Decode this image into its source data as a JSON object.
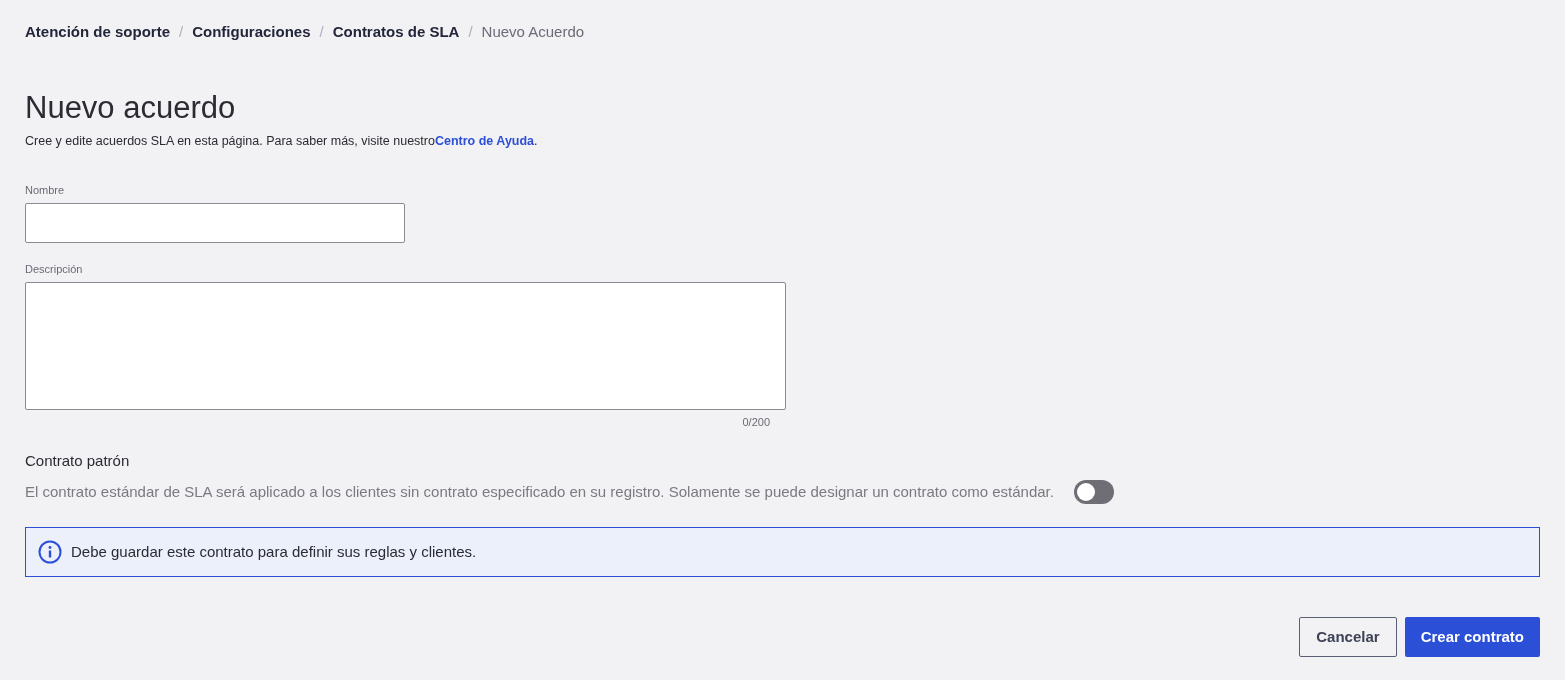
{
  "breadcrumb": [
    {
      "label": "Atención de soporte",
      "current": false
    },
    {
      "label": "Configuraciones",
      "current": false
    },
    {
      "label": "Contratos de SLA",
      "current": false
    },
    {
      "label": "Nuevo Acuerdo",
      "current": true
    }
  ],
  "breadcrumb_separator": "/",
  "title": "Nuevo acuerdo",
  "intro": {
    "text": "Cree y edite acuerdos SLA en esta página. Para saber más, visite nuestro",
    "link": "Centro de Ayuda",
    "suffix": "."
  },
  "name_field": {
    "label": "Nombre"
  },
  "description_field": {
    "label": "Descripción",
    "counter": "0/200"
  },
  "default_contract": {
    "heading": "Contrato patrón",
    "text": "El contrato estándar de SLA será aplicado a los clientes sin contrato especificado en su registro. Solamente se puede designar un contrato como estándar.",
    "on": false
  },
  "info": {
    "text": "Debe guardar este contrato para definir sus reglas y clientes."
  },
  "buttons": [
    {
      "label": "Cancelar",
      "kind": "secondary"
    },
    {
      "label": "Crear contrato",
      "kind": "primary"
    }
  ]
}
